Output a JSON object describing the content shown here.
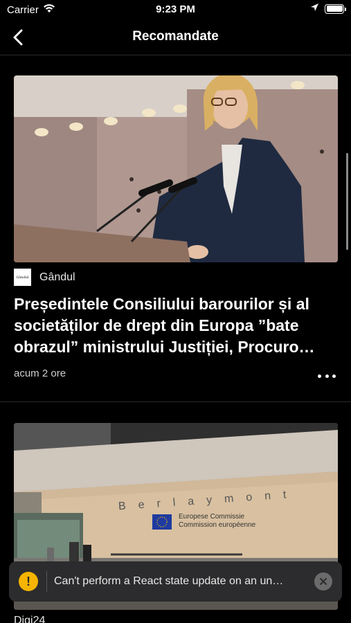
{
  "status_bar": {
    "carrier": "Carrier",
    "time": "9:23 PM"
  },
  "nav": {
    "title": "Recomandate"
  },
  "articles": [
    {
      "source_logo_text": "Gândul",
      "source": "Gândul",
      "headline": "Președintele Consiliului barourilor și al societăților de drept din Europa ”bate obrazul” ministrului Justiției, Procuro…",
      "time": "acum 2 ore"
    },
    {
      "building_sign": "Berlaymont",
      "plaque_line1": "Europese Commissie",
      "plaque_line2": "Commission européenne",
      "source": "Digi24"
    }
  ],
  "toast": {
    "icon": "!",
    "message": "Can't perform a React state update on an un…"
  },
  "colors": {
    "background": "#000000",
    "toast_bg": "#2c2c2e",
    "warning": "#f5b400"
  }
}
